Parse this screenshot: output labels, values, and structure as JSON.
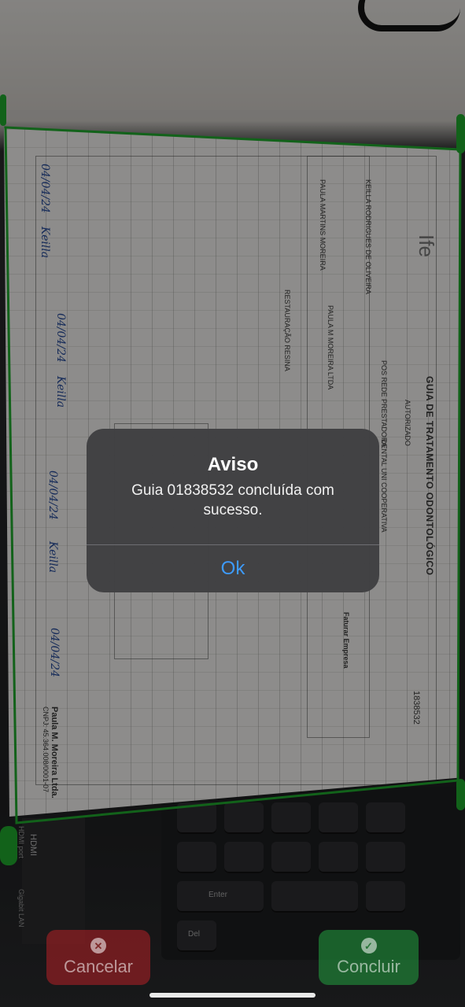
{
  "document": {
    "brand": "Ife",
    "form_title": "GUIA DE TRATAMENTO ODONTOLÓGICO",
    "guide_number": "1838532",
    "patient_name": "KEILLA RODRIGUES DE OLIVEIRA",
    "professional_name": "PAULA MARTINS MOREIRA",
    "company_name": "PAULA M MOREIRA LTDA",
    "procedure": "RESTAURAÇÃO RESINA",
    "status": "AUTORIZADO",
    "network": "POS REDE PRESTADORA",
    "plan": "DENTAL UNI COOPERATIVA",
    "invoice_label": "Faturar Empresa",
    "stamp_line1": "Paula M. Moreira Ltda.",
    "stamp_line2": "CNPJ: 45.364.008/0001-07",
    "date_handwritten": "04/04/24",
    "signature": "Keilla",
    "computer_labels": {
      "hdmi": "HDMI",
      "hdmi_port": "HDMI port",
      "gigabit": "Gigabit LAN",
      "enter_key": "Enter",
      "del_key": "Del"
    }
  },
  "alert": {
    "title": "Aviso",
    "message": "Guia 01838532 concluída com sucesso.",
    "ok_label": "Ok",
    "accent_color": "#3d9bff"
  },
  "actions": {
    "cancel_label": "Cancelar",
    "cancel_icon": "x-circle-icon",
    "done_label": "Concluir",
    "done_icon": "checkmark-circle-icon",
    "cancel_color": "#a82024",
    "done_color": "#22963c"
  },
  "outline_color": "#1faa2d"
}
